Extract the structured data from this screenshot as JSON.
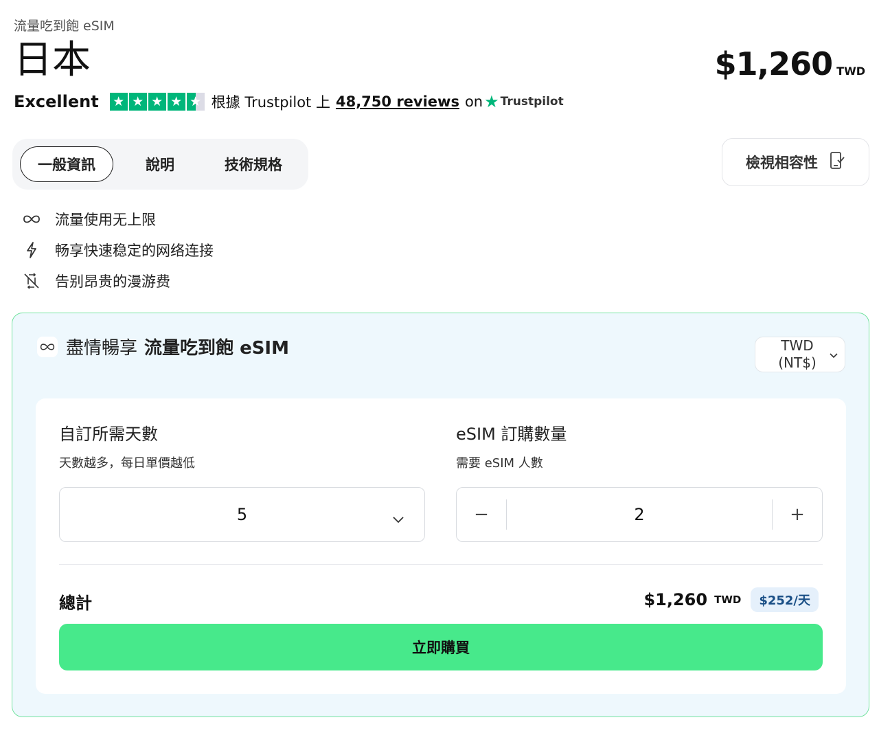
{
  "header": {
    "subtitle": "流量吃到飽 eSIM",
    "country": "日本",
    "price": "$1,260",
    "price_currency": "TWD"
  },
  "rating": {
    "label": "Excellent",
    "stars": 4.5,
    "text_prefix": "根據 Trustpilot 上",
    "reviews_link": "48,750 reviews",
    "on_text": "on",
    "brand": "Trustpilot",
    "star_color": "#00b67a"
  },
  "tabs": [
    {
      "label": "一般資訊",
      "active": true
    },
    {
      "label": "說明",
      "active": false
    },
    {
      "label": "技術規格",
      "active": false
    }
  ],
  "compat_button": {
    "label": "檢視相容性",
    "icon": "phone-check-icon"
  },
  "features": [
    {
      "icon": "infinity-icon",
      "text": "流量使用无上限"
    },
    {
      "icon": "lightning-icon",
      "text": "畅享快速稳定的网络连接"
    },
    {
      "icon": "no-roaming-icon",
      "text": "告别昂贵的漫游费"
    }
  ],
  "plan": {
    "title_light": "盡情暢享",
    "title_bold": "流量吃到飽 eSIM",
    "currency_select": "TWD (NT$)",
    "days": {
      "title": "自訂所需天數",
      "subtitle": "天數越多，每日單價越低",
      "value": "5"
    },
    "quantity": {
      "title": "eSIM 訂購數量",
      "subtitle": "需要 eSIM 人數",
      "value": "2",
      "minus": "−",
      "plus": "+"
    },
    "total": {
      "label": "總計",
      "amount": "$1,260",
      "currency": "TWD",
      "per_day": "$252/天"
    },
    "buy_label": "立即購買"
  },
  "colors": {
    "accent_green": "#47e98b",
    "card_border": "#74e3a0",
    "card_bg": "#eef8fd"
  }
}
